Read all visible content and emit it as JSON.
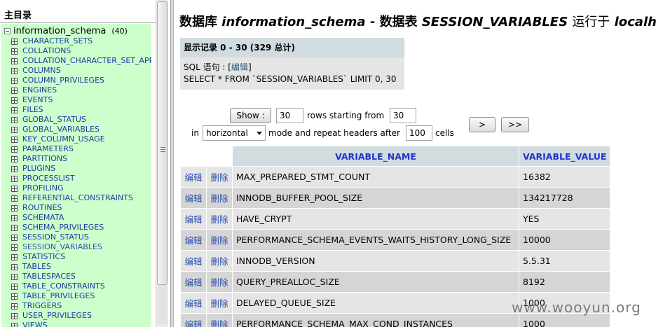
{
  "left": {
    "title": "主目录",
    "db_name": "information_schema",
    "db_count": "(40)",
    "tables": [
      "CHARACTER_SETS",
      "COLLATIONS",
      "COLLATION_CHARACTER_SET_APPLICABILITY",
      "COLUMNS",
      "COLUMN_PRIVILEGES",
      "ENGINES",
      "EVENTS",
      "FILES",
      "GLOBAL_STATUS",
      "GLOBAL_VARIABLES",
      "KEY_COLUMN_USAGE",
      "PARAMETERS",
      "PARTITIONS",
      "PLUGINS",
      "PROCESSLIST",
      "PROFILING",
      "REFERENTIAL_CONSTRAINTS",
      "ROUTINES",
      "SCHEMATA",
      "SCHEMA_PRIVILEGES",
      "SESSION_STATUS",
      "SESSION_VARIABLES",
      "STATISTICS",
      "TABLES",
      "TABLESPACES",
      "TABLE_CONSTRAINTS",
      "TABLE_PRIVILEGES",
      "TRIGGERS",
      "USER_PRIVILEGES",
      "VIEWS"
    ],
    "current_table": "SESSION_VARIABLES"
  },
  "title": {
    "prefix_db": "数据库",
    "db": "information_schema",
    "sep": "-",
    "prefix_table": "数据表",
    "table": "SESSION_VARIABLES",
    "prefix_host": "运行于",
    "host": "localhost"
  },
  "info": {
    "count_text": "显示记录 0 - 30 (329 总计)",
    "sql_label": "SQL 语句 :",
    "edit_link": "编辑",
    "sql": "SELECT * FROM `SESSION_VARIABLES` LIMIT 0, 30"
  },
  "nav": {
    "show_button": "Show :",
    "rows_value": "30",
    "rows_label": "rows starting from",
    "start_value": "30",
    "in_label": "in",
    "mode_value": "horizontal",
    "mode_label": "mode and repeat headers after",
    "repeat_value": "100",
    "cells_label": "cells",
    "next_button": ">",
    "last_button": ">>"
  },
  "table": {
    "headers": [
      "VARIABLE_NAME",
      "VARIABLE_VALUE"
    ],
    "edit_label": "编辑",
    "delete_label": "删除",
    "rows": [
      [
        "MAX_PREPARED_STMT_COUNT",
        "16382"
      ],
      [
        "INNODB_BUFFER_POOL_SIZE",
        "134217728"
      ],
      [
        "HAVE_CRYPT",
        "YES"
      ],
      [
        "PERFORMANCE_SCHEMA_EVENTS_WAITS_HISTORY_LONG_SIZE",
        "10000"
      ],
      [
        "INNODB_VERSION",
        "5.5.31"
      ],
      [
        "QUERY_PREALLOC_SIZE",
        "8192"
      ],
      [
        "DELAYED_QUEUE_SIZE",
        "1000"
      ],
      [
        "PERFORMANCE_SCHEMA_MAX_COND_INSTANCES",
        "1000"
      ]
    ]
  },
  "watermark": "www.wooyun.org"
}
